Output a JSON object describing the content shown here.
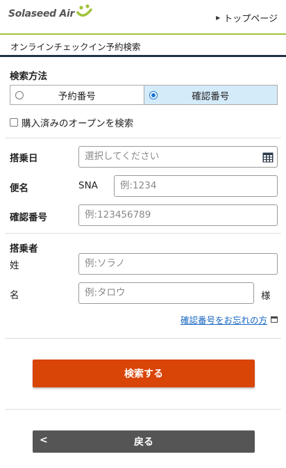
{
  "header": {
    "logo_text": "Solaseed Air",
    "top_link": "トップページ",
    "brand_color": "#9fc33a"
  },
  "page_title": "オンラインチェックイン予約検索",
  "search_method": {
    "label": "検索方法",
    "options": [
      {
        "label": "予約番号",
        "selected": false
      },
      {
        "label": "確認番号",
        "selected": true
      }
    ]
  },
  "open_ticket": {
    "label": "購入済みのオープンを検索",
    "checked": false
  },
  "boarding_date": {
    "label": "搭乗日",
    "placeholder": "選択してください"
  },
  "flight": {
    "label": "便名",
    "prefix": "SNA",
    "placeholder": "例:1234"
  },
  "confirmation": {
    "label": "確認番号",
    "placeholder": "例:123456789"
  },
  "passenger": {
    "label": "搭乗者",
    "last_name_label": "姓",
    "last_name_placeholder": "例:ソラノ",
    "first_name_label": "名",
    "first_name_placeholder": "例:タロウ",
    "suffix": "様"
  },
  "forgot_link": "確認番号をお忘れの方",
  "buttons": {
    "search": "検索する",
    "back": "戻る",
    "search_color": "#d94407",
    "back_color": "#555555"
  }
}
